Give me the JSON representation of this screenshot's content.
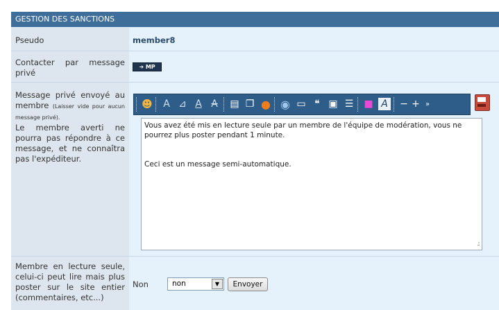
{
  "header": {
    "title": "GESTION DES SANCTIONS"
  },
  "rows": {
    "pseudo": {
      "label": "Pseudo",
      "value": "member8"
    },
    "contact": {
      "label": "Contacter par message privé",
      "button_label": "MP"
    },
    "message": {
      "label_main": "Message privé envoyé au membre",
      "label_small": "(Laisser vide pour aucun message privé).",
      "label_note": "Le membre averti ne pourra pas répondre à ce message, et ne connaîtra pas l'expéditeur.",
      "text_line1": "Vous avez été mis en lecture seule par un membre de l'équipe de modération, vous ne pourrez plus poster pendant 1 minute.",
      "text_line2": "Ceci est un message semi-automatique."
    },
    "readonly": {
      "label": "Membre en lecture seule, celui-ci peut lire mais plus poster sur le site entier (commentaires, etc...)",
      "current_label": "Non",
      "select_value": "non",
      "send_label": "Envoyer"
    }
  },
  "toolbar_icons": [
    "smiley-icon",
    "bold-icon",
    "italic-icon",
    "underline-icon",
    "strike-icon",
    "align-icon",
    "copy-icon",
    "warning-icon",
    "globe-icon",
    "image-icon",
    "quote-icon",
    "lock-icon",
    "list-icon",
    "color-icon",
    "font-icon",
    "decrease-icon",
    "increase-icon",
    "more-icon"
  ]
}
